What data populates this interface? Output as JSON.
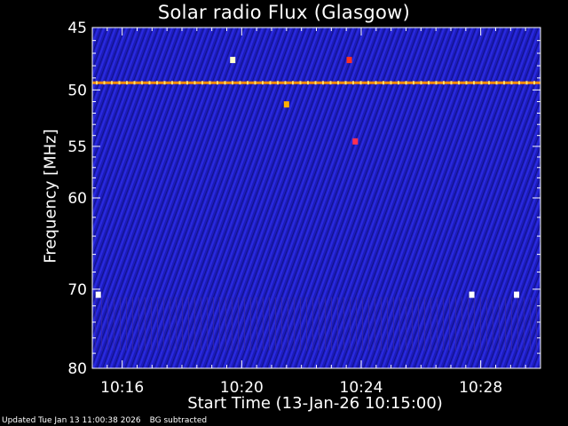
{
  "header": {
    "title": "Solar radio Flux (Glasgow)"
  },
  "footer": {
    "updated": "Updated Tue Jan 13 11:00:38 2026",
    "note": "BG subtracted"
  },
  "chart_data": {
    "type": "heatmap",
    "title": "Solar radio Flux (Glasgow)",
    "xlabel": "Start Time (13-Jan-26 10:15:00)",
    "ylabel": "Frequency [MHz]",
    "x_unit": "minutes after 10:15:00",
    "xlim": [
      0,
      15
    ],
    "ylim": [
      45,
      80
    ],
    "y_scale": "log",
    "x_ticks": [
      {
        "value": 1,
        "label": "10:16"
      },
      {
        "value": 5,
        "label": "10:20"
      },
      {
        "value": 9,
        "label": "10:24"
      },
      {
        "value": 13,
        "label": "10:28"
      }
    ],
    "y_ticks": [
      {
        "value": 45,
        "label": "45"
      },
      {
        "value": 50,
        "label": "50"
      },
      {
        "value": 55,
        "label": "55"
      },
      {
        "value": 60,
        "label": "60"
      },
      {
        "value": 70,
        "label": "70"
      },
      {
        "value": 80,
        "label": "80"
      }
    ],
    "background_color": "#1a1ab8",
    "features": [
      {
        "name": "persistent-interference-line",
        "freq_mhz": 49.4,
        "color": "#ff8c00"
      },
      {
        "name": "interference-blob",
        "time_min": 4.7,
        "freq_mhz": 47.5,
        "color": "#ffffcc"
      },
      {
        "name": "interference-blob",
        "time_min": 8.6,
        "freq_mhz": 47.5,
        "color": "#ff3020"
      },
      {
        "name": "interference-blob",
        "time_min": 6.5,
        "freq_mhz": 51.2,
        "color": "#ffb000"
      },
      {
        "name": "interference-blob",
        "time_min": 8.8,
        "freq_mhz": 54.5,
        "color": "#ff3050"
      },
      {
        "name": "interference-blob",
        "time_min": 0.2,
        "freq_mhz": 70.6,
        "color": "#ffffff"
      },
      {
        "name": "interference-blob",
        "time_min": 12.7,
        "freq_mhz": 70.6,
        "color": "#ffffff"
      },
      {
        "name": "interference-blob",
        "time_min": 14.2,
        "freq_mhz": 70.6,
        "color": "#ffffff"
      }
    ]
  }
}
